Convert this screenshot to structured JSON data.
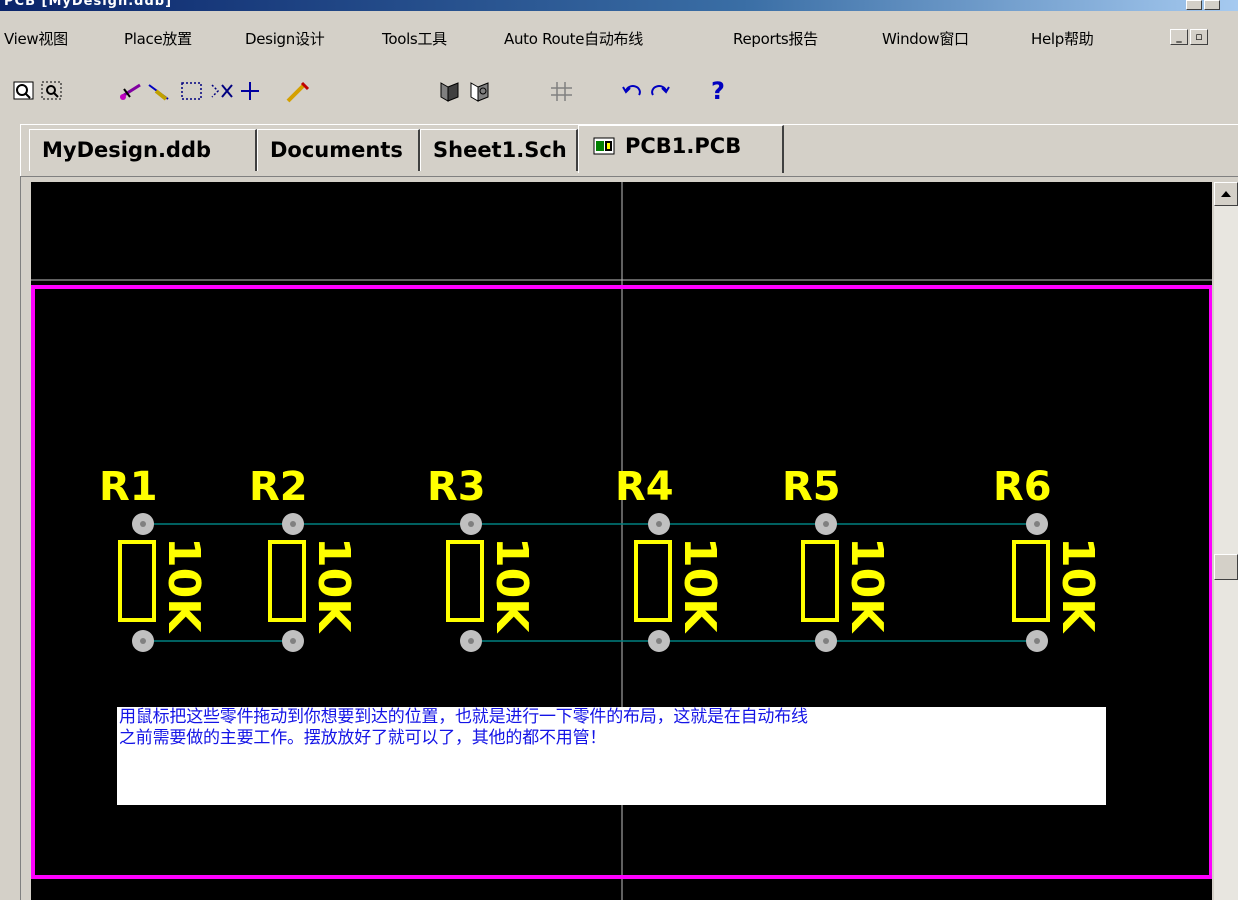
{
  "window": {
    "title": "PCB [MyDesign.ddb]"
  },
  "menu": {
    "items": [
      {
        "label": "View视图"
      },
      {
        "label": "Place放置"
      },
      {
        "label": "Design设计"
      },
      {
        "label": "Tools工具"
      },
      {
        "label": "Auto Route自动布线"
      },
      {
        "label": "Reports报告"
      },
      {
        "label": "Window窗口"
      },
      {
        "label": "Help帮助"
      }
    ]
  },
  "toolbar": {
    "icons": [
      "zoom-fit-icon",
      "zoom-area-icon",
      "wire-icon",
      "line-icon",
      "select-icon",
      "deselect-icon",
      "move-icon",
      "highlight-icon",
      "library-icon",
      "browse-icon",
      "grid-icon",
      "undo-icon",
      "redo-icon",
      "help-icon"
    ]
  },
  "tabs": [
    {
      "label": "MyDesign.ddb"
    },
    {
      "label": "Documents"
    },
    {
      "label": "Sheet1.Sch"
    },
    {
      "label": "PCB1.PCB",
      "active": true
    }
  ],
  "pcb": {
    "components": [
      {
        "designator": "R1",
        "value": "10K"
      },
      {
        "designator": "R2",
        "value": "10K"
      },
      {
        "designator": "R3",
        "value": "10K"
      },
      {
        "designator": "R4",
        "value": "10K"
      },
      {
        "designator": "R5",
        "value": "10K"
      },
      {
        "designator": "R6",
        "value": "10K"
      }
    ],
    "colors": {
      "background": "#000000",
      "board_outline": "#ff00ff",
      "silkscreen": "#ffff00",
      "pad": "#c0c0c0",
      "ratsnest": "#008080",
      "note_text": "#1414e6"
    },
    "note": {
      "line1": "用鼠标把这些零件拖动到你想要到达的位置，也就是进行一下零件的布局，这就是在自动布线",
      "line2": "之前需要做的主要工作。摆放放好了就可以了，其他的都不用管！"
    }
  }
}
